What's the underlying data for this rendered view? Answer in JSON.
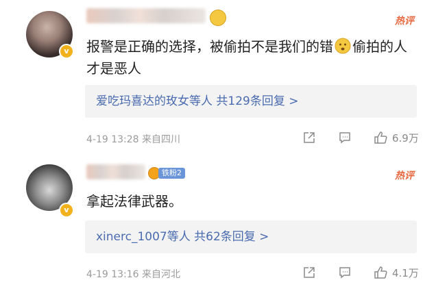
{
  "comments": [
    {
      "hot_label": "热评",
      "text_part1": "报警是正确的选择，被偷拍不是我们的错",
      "text_part2": "偷拍的人才是恶人",
      "replies_text": "爱吃玛喜达的玫女等人 共129条回复 >",
      "time": "4-19 13:28",
      "source": "来自四川",
      "likes": "6.9万"
    },
    {
      "medal_label": "铁粉2",
      "hot_label": "热评",
      "text": "拿起法律武器。",
      "replies_text": "xinerc_1007等人 共62条回复 >",
      "time": "4-19 13:16",
      "source": "来自河北",
      "likes": "4.1万"
    }
  ],
  "icons": [
    "share-icon",
    "comment-icon",
    "like-icon",
    "verified-badge-icon",
    "emoji-icon"
  ],
  "colors": {
    "hot": "#e8683f",
    "link": "#4a6bb0",
    "meta": "#9a9a9a",
    "reply_bg": "#f3f3f3",
    "verified": "#f2b21b"
  }
}
